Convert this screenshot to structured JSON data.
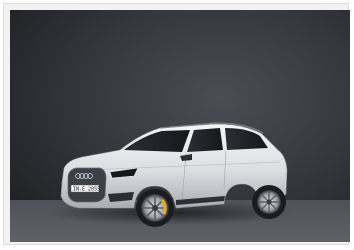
{
  "image": {
    "subject": "car-photo",
    "license_plate": "IN-E 2055",
    "colors": {
      "studio_backdrop": "#3a3d42",
      "floor": "#565a60",
      "car_body": "#e6e8ea",
      "glass": "#1e2226",
      "brake_caliper": "#e0b21c",
      "frame": "#f2f2f2"
    }
  }
}
